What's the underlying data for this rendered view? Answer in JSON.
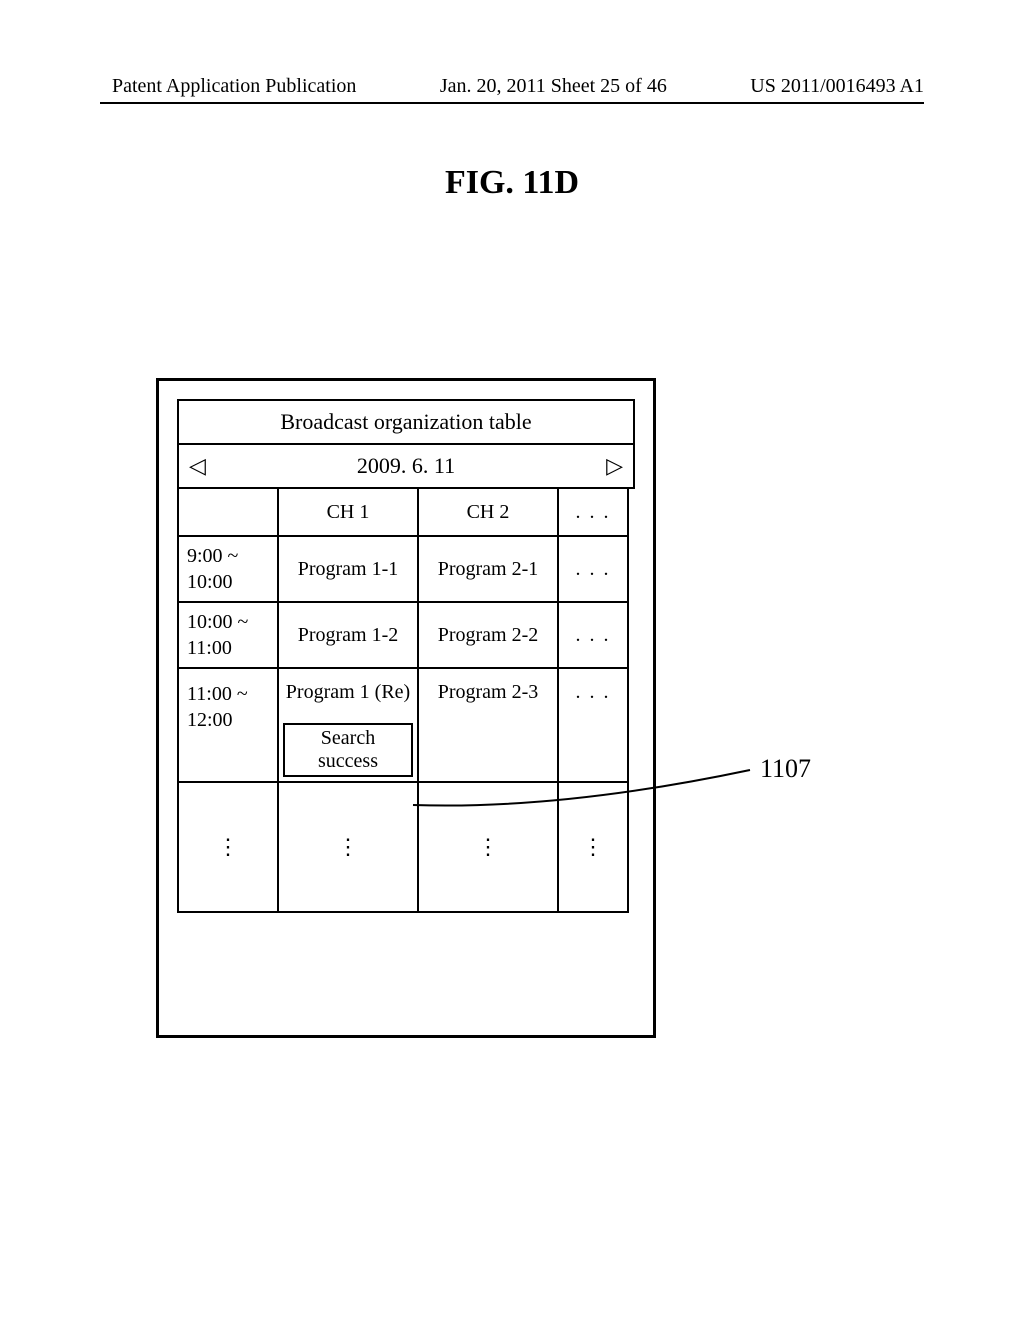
{
  "header": {
    "left": "Patent Application Publication",
    "center": "Jan. 20, 2011  Sheet 25 of 46",
    "right": "US 2011/0016493 A1"
  },
  "figure": {
    "title": "FIG. 11D"
  },
  "epg": {
    "title": "Broadcast organization table",
    "date": "2009. 6. 11",
    "arrows": {
      "left": "◁",
      "right": "▷"
    },
    "columns": {
      "time": "",
      "ch1": "CH 1",
      "ch2": "CH 2",
      "more": ". . ."
    },
    "rows": [
      {
        "time": "9:00 ~\n10:00",
        "ch1": "Program 1-1",
        "ch2": "Program 2-1",
        "more": ". . ."
      },
      {
        "time": "10:00 ~\n11:00",
        "ch1": "Program 1-2",
        "ch2": "Program 2-2",
        "more": ". . ."
      },
      {
        "time": "11:00 ~\n12:00",
        "ch1": "Program 1 (Re)",
        "ch1_badge": "Search success",
        "ch2": "Program 2-3",
        "more": ". . ."
      }
    ],
    "vdots": "⋮"
  },
  "reference": {
    "label": "1107"
  }
}
